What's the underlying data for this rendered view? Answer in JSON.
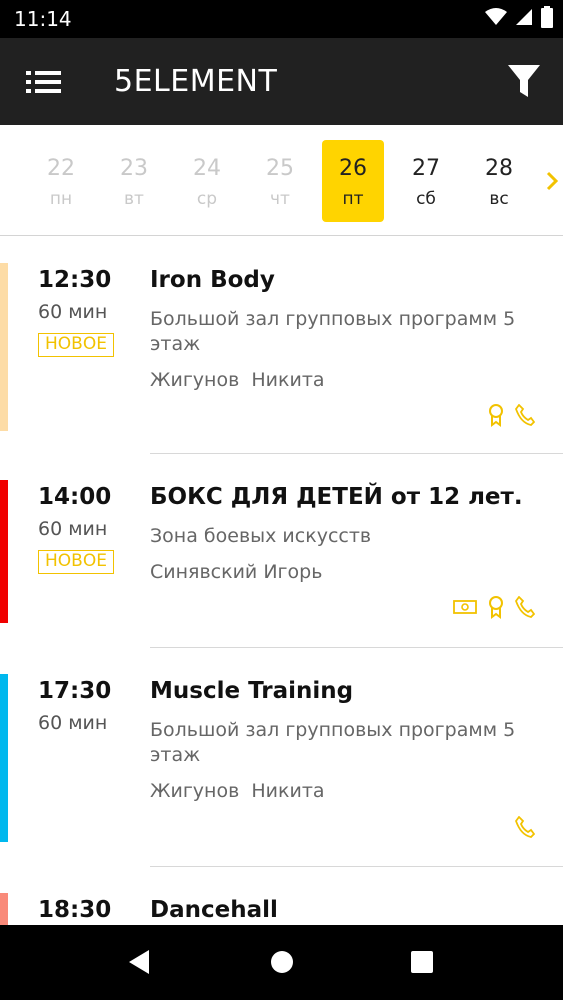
{
  "status_bar": {
    "time": "11:14"
  },
  "app_bar": {
    "title": "5ELEMENT"
  },
  "dates": [
    {
      "day": "22",
      "weekday": "пн",
      "state": "past"
    },
    {
      "day": "23",
      "weekday": "вт",
      "state": "past"
    },
    {
      "day": "24",
      "weekday": "ср",
      "state": "past"
    },
    {
      "day": "25",
      "weekday": "чт",
      "state": "past"
    },
    {
      "day": "26",
      "weekday": "пт",
      "state": "selected"
    },
    {
      "day": "27",
      "weekday": "сб",
      "state": "future"
    },
    {
      "day": "28",
      "weekday": "вс",
      "state": "future"
    }
  ],
  "classes": [
    {
      "time": "12:30",
      "duration": "60 мин",
      "badge": "НОВОЕ",
      "name": "Iron Body",
      "room": "Большой зал групповых программ 5 этаж",
      "coach": "Жигунов  Никита",
      "stripe_color": "#fddca6",
      "icons": [
        "award-icon",
        "phone-icon"
      ]
    },
    {
      "time": "14:00",
      "duration": "60 мин",
      "badge": "НОВОЕ",
      "name": "БОКС ДЛЯ ДЕТЕЙ от 12 лет.",
      "room": "Зона боевых искусств",
      "coach": "Синявский Игорь",
      "stripe_color": "#f00000",
      "icons": [
        "money-icon",
        "award-icon",
        "phone-icon"
      ]
    },
    {
      "time": "17:30",
      "duration": "60 мин",
      "badge": "",
      "name": "Muscle Training",
      "room": "Большой зал групповых программ 5 этаж",
      "coach": "Жигунов  Никита",
      "stripe_color": "#00b8ee",
      "icons": [
        "phone-icon"
      ]
    },
    {
      "time": "18:30",
      "duration": "",
      "badge": "",
      "name": "Dancehall",
      "room": "",
      "coach": "",
      "stripe_color": "#f98a7a",
      "icons": []
    }
  ],
  "colors": {
    "accent": "#ffd400",
    "icon_accent": "#f2c200",
    "app_bar": "#212121"
  }
}
